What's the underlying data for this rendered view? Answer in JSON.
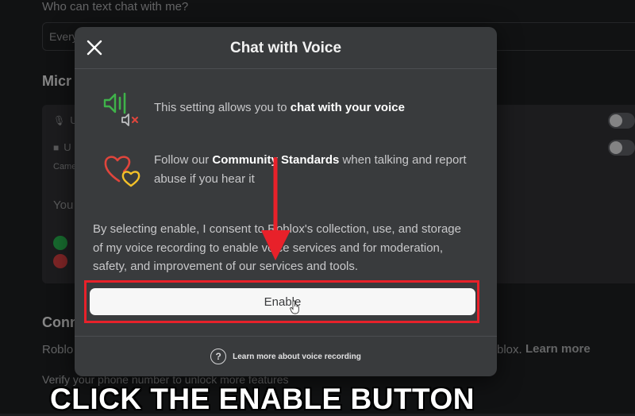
{
  "background": {
    "text_chat_question": "Who can text chat with me?",
    "text_chat_value": "Every",
    "mic_heading": "Micr",
    "row1_label": "U",
    "row2_label": "U",
    "camera_label": "Came",
    "you_text": "You",
    "conn_heading": "Conn",
    "roblox_text": "Roblo",
    "roblox_suffix": "blox.",
    "learn_more_link": "Learn more",
    "verify_text": "Verify your phone number to unlock more features"
  },
  "modal": {
    "title": "Chat with Voice",
    "voice_row": {
      "prefix": "This setting allows you to ",
      "bold": "chat with your voice"
    },
    "standards_row": {
      "prefix": "Follow our ",
      "bold": "Community Standards",
      "suffix": " when talking and report abuse if you hear it"
    },
    "consent_text": "By selecting enable, I consent to Roblox's collection, use, and storage of my voice recording to enable voice services and for moderation, safety, and improvement of our services and tools.",
    "enable_label": "Enable",
    "learn_more_label": "Learn more about voice recording"
  },
  "overlay": {
    "caption": "CLICK THE ENABLE BUTTON",
    "highlight_color": "#e8212a"
  },
  "colors": {
    "speaker_green": "#3fb24a",
    "mute_red": "#e0453c",
    "heart_red": "#e0453c",
    "heart_yellow": "#f2c029",
    "dot_green": "#24a148",
    "dot_red": "#c0393b"
  }
}
